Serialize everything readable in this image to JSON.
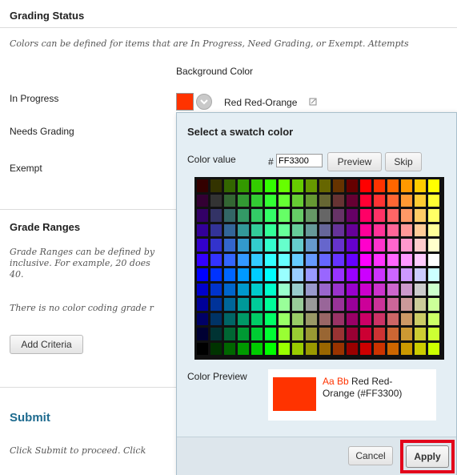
{
  "grading_status": {
    "title": "Grading Status",
    "description": "Colors can be defined for items that are In Progress, Need Grading, or Exempt. Attempts",
    "background_color_header": "Background Color",
    "rows": [
      {
        "label": "In Progress",
        "color_name": "Red Red-Orange",
        "color": "#FF3300"
      },
      {
        "label": "Needs Grading"
      },
      {
        "label": "Exempt"
      }
    ]
  },
  "grade_ranges": {
    "title": "Grade Ranges",
    "description_line1": "Grade Ranges can be defined by",
    "description_line2": "inclusive. For example, 20 does",
    "description_line3": "40.",
    "no_criteria_note": "There is no color coding grade r",
    "add_criteria_label": "Add Criteria"
  },
  "submit_section": {
    "title": "Submit",
    "description": "Click Submit to proceed. Click"
  },
  "swatch_popup": {
    "title": "Select a swatch color",
    "color_value_label": "Color value",
    "hash": "#",
    "color_value": "FF3300",
    "preview_label": "Preview",
    "skip_label": "Skip",
    "color_preview_label": "Color Preview",
    "sample_text": "Aa Bb",
    "preview_name_line1": "Red Red-",
    "preview_name_line2": "Orange (#FF3300)",
    "preview_color": "#FF3300",
    "cancel_label": "Cancel",
    "apply_label": "Apply",
    "palette_rows": [
      [
        "#330000",
        "#333300",
        "#336600",
        "#339900",
        "#33CC00",
        "#33FF00",
        "#66FF00",
        "#66CC00",
        "#669900",
        "#666600",
        "#663300",
        "#660000",
        "#FF0000",
        "#FF3300",
        "#FF6600",
        "#FF9900",
        "#FFCC00",
        "#FFFF00"
      ],
      [
        "#330033",
        "#333333",
        "#336633",
        "#339933",
        "#33CC33",
        "#33FF33",
        "#66FF33",
        "#66CC33",
        "#669933",
        "#666633",
        "#663333",
        "#660033",
        "#FF0033",
        "#FF3333",
        "#FF6633",
        "#FF9933",
        "#FFCC33",
        "#FFFF33"
      ],
      [
        "#330066",
        "#333366",
        "#336666",
        "#339966",
        "#33CC66",
        "#33FF66",
        "#66FF66",
        "#66CC66",
        "#669966",
        "#666666",
        "#663366",
        "#660066",
        "#FF0066",
        "#FF3366",
        "#FF6666",
        "#FF9966",
        "#FFCC66",
        "#FFFF66"
      ],
      [
        "#330099",
        "#333399",
        "#336699",
        "#339999",
        "#33CC99",
        "#33FF99",
        "#66FF99",
        "#66CC99",
        "#669999",
        "#666699",
        "#663399",
        "#660099",
        "#FF0099",
        "#FF3399",
        "#FF6699",
        "#FF9999",
        "#FFCC99",
        "#FFFF99"
      ],
      [
        "#3300CC",
        "#3333CC",
        "#3366CC",
        "#3399CC",
        "#33CCCC",
        "#33FFCC",
        "#66FFCC",
        "#66CCCC",
        "#6699CC",
        "#6666CC",
        "#6633CC",
        "#6600CC",
        "#FF00CC",
        "#FF33CC",
        "#FF66CC",
        "#FF99CC",
        "#FFCCCC",
        "#FFFFCC"
      ],
      [
        "#3300FF",
        "#3333FF",
        "#3366FF",
        "#3399FF",
        "#33CCFF",
        "#33FFFF",
        "#66FFFF",
        "#66CCFF",
        "#6699FF",
        "#6666FF",
        "#6633FF",
        "#6600FF",
        "#FF00FF",
        "#FF33FF",
        "#FF66FF",
        "#FF99FF",
        "#FFCCFF",
        "#FFFFFF"
      ],
      [
        "#0000FF",
        "#0033FF",
        "#0066FF",
        "#0099FF",
        "#00CCFF",
        "#00FFFF",
        "#99FFFF",
        "#99CCFF",
        "#9999FF",
        "#9966FF",
        "#9933FF",
        "#9900FF",
        "#CC00FF",
        "#CC33FF",
        "#CC66FF",
        "#CC99FF",
        "#CCCCFF",
        "#CCFFFF"
      ],
      [
        "#0000CC",
        "#0033CC",
        "#0066CC",
        "#0099CC",
        "#00CCCC",
        "#00FFCC",
        "#99FFCC",
        "#99CCCC",
        "#9999CC",
        "#9966CC",
        "#9933CC",
        "#9900CC",
        "#CC00CC",
        "#CC33CC",
        "#CC66CC",
        "#CC99CC",
        "#CCCCCC",
        "#CCFFCC"
      ],
      [
        "#000099",
        "#003399",
        "#006699",
        "#009999",
        "#00CC99",
        "#00FF99",
        "#99FF99",
        "#99CC99",
        "#999999",
        "#996699",
        "#993399",
        "#990099",
        "#CC0099",
        "#CC3399",
        "#CC6699",
        "#CC9999",
        "#CCCC99",
        "#CCFF99"
      ],
      [
        "#000066",
        "#003366",
        "#006666",
        "#009966",
        "#00CC66",
        "#00FF66",
        "#99FF66",
        "#99CC66",
        "#999966",
        "#996666",
        "#993366",
        "#990066",
        "#CC0066",
        "#CC3366",
        "#CC6666",
        "#CC9966",
        "#CCCC66",
        "#CCFF66"
      ],
      [
        "#000033",
        "#003333",
        "#006633",
        "#009933",
        "#00CC33",
        "#00FF33",
        "#99FF33",
        "#99CC33",
        "#999933",
        "#996633",
        "#993333",
        "#990033",
        "#CC0033",
        "#CC3333",
        "#CC6633",
        "#CC9933",
        "#CCCC33",
        "#CCFF33"
      ],
      [
        "#000000",
        "#003300",
        "#006600",
        "#009900",
        "#00CC00",
        "#00FF00",
        "#99FF00",
        "#99CC00",
        "#999900",
        "#996600",
        "#993300",
        "#990000",
        "#CC0000",
        "#CC3300",
        "#CC6600",
        "#CC9900",
        "#CCCC00",
        "#CCFF00"
      ]
    ]
  },
  "colors": {
    "submit_heading": "#1e6b8f",
    "highlight": "#e3051b"
  },
  "icons": {
    "dropdown": "chevron-down-circle-icon",
    "edit": "edit-icon"
  }
}
